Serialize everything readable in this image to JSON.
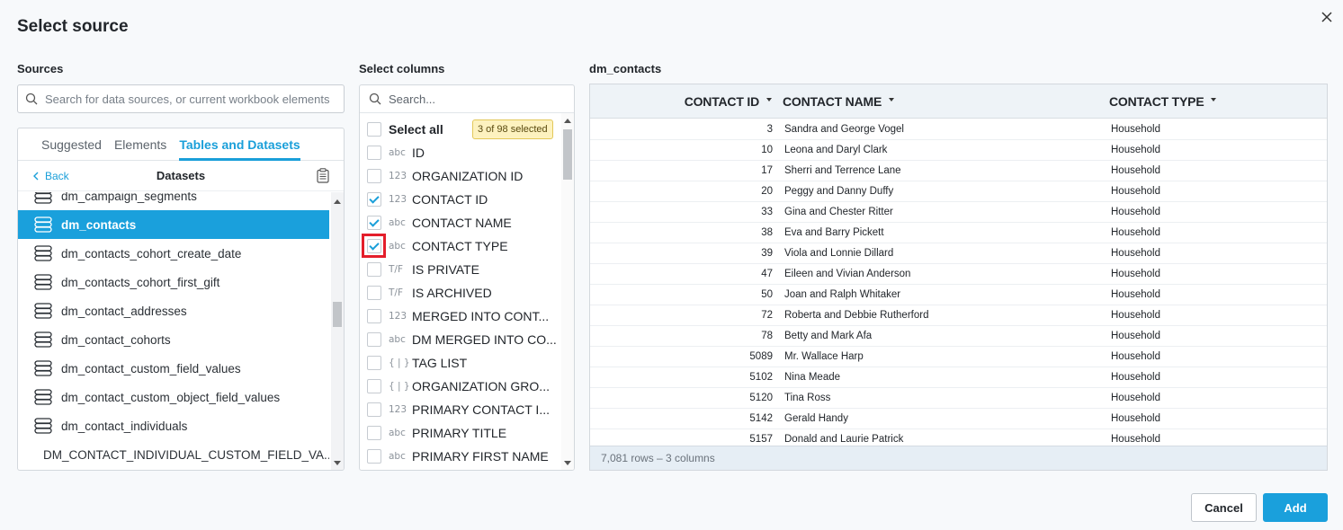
{
  "dialog": {
    "title": "Select source",
    "close_label": "×"
  },
  "sources": {
    "label": "Sources",
    "search_placeholder": "Search for data sources, or current workbook elements",
    "tabs": [
      {
        "label": "Suggested",
        "active": false
      },
      {
        "label": "Elements",
        "active": false
      },
      {
        "label": "Tables and Datasets",
        "active": true
      }
    ],
    "back_label": "Back",
    "header_title": "Datasets",
    "items": [
      {
        "label": "dm_campaign_segments",
        "selected": false
      },
      {
        "label": "dm_contacts",
        "selected": true
      },
      {
        "label": "dm_contacts_cohort_create_date",
        "selected": false
      },
      {
        "label": "dm_contacts_cohort_first_gift",
        "selected": false
      },
      {
        "label": "dm_contact_addresses",
        "selected": false
      },
      {
        "label": "dm_contact_cohorts",
        "selected": false
      },
      {
        "label": "dm_contact_custom_field_values",
        "selected": false
      },
      {
        "label": "dm_contact_custom_object_field_values",
        "selected": false
      },
      {
        "label": "dm_contact_individuals",
        "selected": false
      },
      {
        "label": "DM_CONTACT_INDIVIDUAL_CUSTOM_FIELD_VA...",
        "selected": false
      }
    ]
  },
  "columns": {
    "label": "Select columns",
    "search_placeholder": "Search...",
    "select_all_label": "Select all",
    "selected_badge": "3 of 98 selected",
    "items": [
      {
        "type": "abc",
        "label": "ID",
        "checked": false
      },
      {
        "type": "123",
        "label": "ORGANIZATION ID",
        "checked": false
      },
      {
        "type": "123",
        "label": "CONTACT ID",
        "checked": true
      },
      {
        "type": "abc",
        "label": "CONTACT NAME",
        "checked": true
      },
      {
        "type": "abc",
        "label": "CONTACT TYPE",
        "checked": true
      },
      {
        "type": "T/F",
        "label": "IS PRIVATE",
        "checked": false
      },
      {
        "type": "T/F",
        "label": "IS ARCHIVED",
        "checked": false
      },
      {
        "type": "123",
        "label": "MERGED INTO CONT...",
        "checked": false
      },
      {
        "type": "abc",
        "label": "DM MERGED INTO CO...",
        "checked": false
      },
      {
        "type": "{ | }",
        "label": "TAG LIST",
        "checked": false
      },
      {
        "type": "{ | }",
        "label": "ORGANIZATION GRO...",
        "checked": false
      },
      {
        "type": "123",
        "label": "PRIMARY CONTACT I...",
        "checked": false
      },
      {
        "type": "abc",
        "label": "PRIMARY TITLE",
        "checked": false
      },
      {
        "type": "abc",
        "label": "PRIMARY FIRST NAME",
        "checked": false
      }
    ]
  },
  "preview": {
    "label": "dm_contacts",
    "headers": [
      "CONTACT ID",
      "CONTACT NAME",
      "CONTACT TYPE"
    ],
    "rows": [
      [
        "3",
        "Sandra and George Vogel",
        "Household"
      ],
      [
        "10",
        "Leona and Daryl Clark",
        "Household"
      ],
      [
        "17",
        "Sherri and Terrence Lane",
        "Household"
      ],
      [
        "20",
        "Peggy and Danny Duffy",
        "Household"
      ],
      [
        "33",
        "Gina and Chester Ritter",
        "Household"
      ],
      [
        "38",
        "Eva and Barry Pickett",
        "Household"
      ],
      [
        "39",
        "Viola and Lonnie Dillard",
        "Household"
      ],
      [
        "47",
        "Eileen and Vivian Anderson",
        "Household"
      ],
      [
        "50",
        "Joan and Ralph Whitaker",
        "Household"
      ],
      [
        "72",
        "Roberta and Debbie Rutherford",
        "Household"
      ],
      [
        "78",
        "Betty and Mark Afa",
        "Household"
      ],
      [
        "5089",
        "Mr. Wallace Harp",
        "Household"
      ],
      [
        "5102",
        "Nina Meade",
        "Household"
      ],
      [
        "5120",
        "Tina Ross",
        "Household"
      ],
      [
        "5142",
        "Gerald Handy",
        "Household"
      ],
      [
        "5157",
        "Donald and Laurie Patrick",
        "Household"
      ]
    ],
    "footer": "7,081 rows – 3 columns"
  },
  "actions": {
    "cancel_label": "Cancel",
    "add_label": "Add"
  },
  "colors": {
    "accent": "#1aa0dc",
    "highlight": "#e41e2b",
    "badge_bg": "#fdf2bf"
  }
}
